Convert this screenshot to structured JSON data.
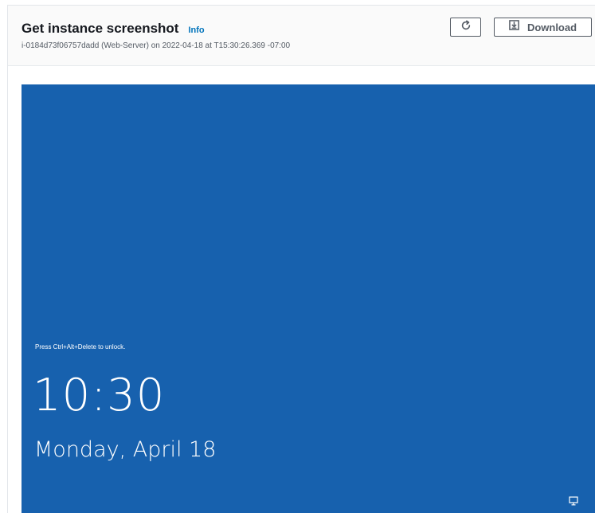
{
  "header": {
    "title": "Get instance screenshot",
    "info_link": "Info",
    "subtitle": "i-0184d73f06757dadd (Web-Server) on 2022-04-18 at T15:30:26.369 -07:00"
  },
  "toolbar": {
    "refresh_icon": "refresh-icon",
    "download_icon": "download-icon",
    "download_label": "Download"
  },
  "screenshot": {
    "background_color": "#1761ae",
    "unlock_hint": "Press Ctrl+Alt+Delete to unlock.",
    "time": "10:30",
    "date": "Monday, April 18",
    "tray_icon": "network-icon"
  },
  "colors": {
    "accent_link": "#0073bb",
    "title_text": "#16191f",
    "muted_text": "#545b64"
  }
}
